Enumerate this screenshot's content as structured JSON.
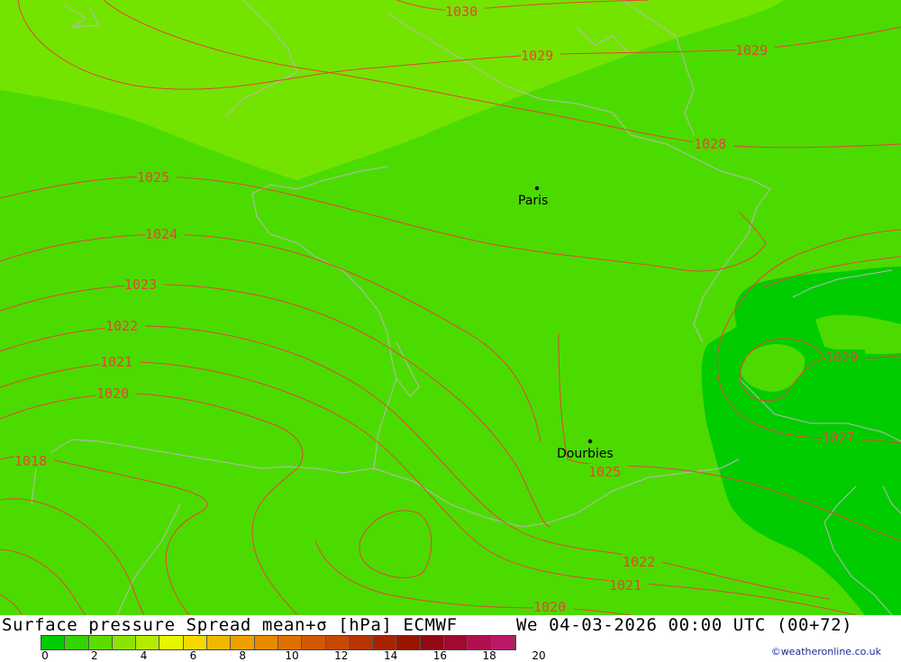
{
  "map": {
    "cities": [
      {
        "name": "Paris"
      },
      {
        "name": "Dourbies"
      }
    ],
    "isobar_labels": [
      "1030",
      "1029",
      "1029",
      "1028",
      "1025",
      "1024",
      "1023",
      "1022",
      "1021",
      "1020",
      "1018",
      "1025",
      "1022",
      "1021",
      "1020",
      "1029",
      "1027"
    ],
    "colors": {
      "spread_0_1": "#00cc00",
      "spread_1_2": "#4cdb00",
      "spread_2_3": "#73e400",
      "isobars": "#e8423a",
      "borders": "#b8b8b8"
    }
  },
  "footer": {
    "title": "Surface pressure Spread mean+σ [hPa] ECMWF",
    "datetime": "We 04-03-2026 00:00 UTC (00+72)",
    "credit": "©weatheronline.co.uk",
    "scale_ticks": [
      "0",
      "2",
      "4",
      "6",
      "8",
      "10",
      "12",
      "14",
      "16",
      "18",
      "20"
    ],
    "scale_colors": [
      "#00cc00",
      "#33d400",
      "#5edc00",
      "#8ae300",
      "#b4ec00",
      "#e6f500",
      "#f5d800",
      "#f0b800",
      "#eda000",
      "#e88a00",
      "#e07000",
      "#d45800",
      "#c84800",
      "#b83400",
      "#a82400",
      "#9a1400",
      "#900a14",
      "#a00a30",
      "#b01050",
      "#bc1868"
    ]
  }
}
